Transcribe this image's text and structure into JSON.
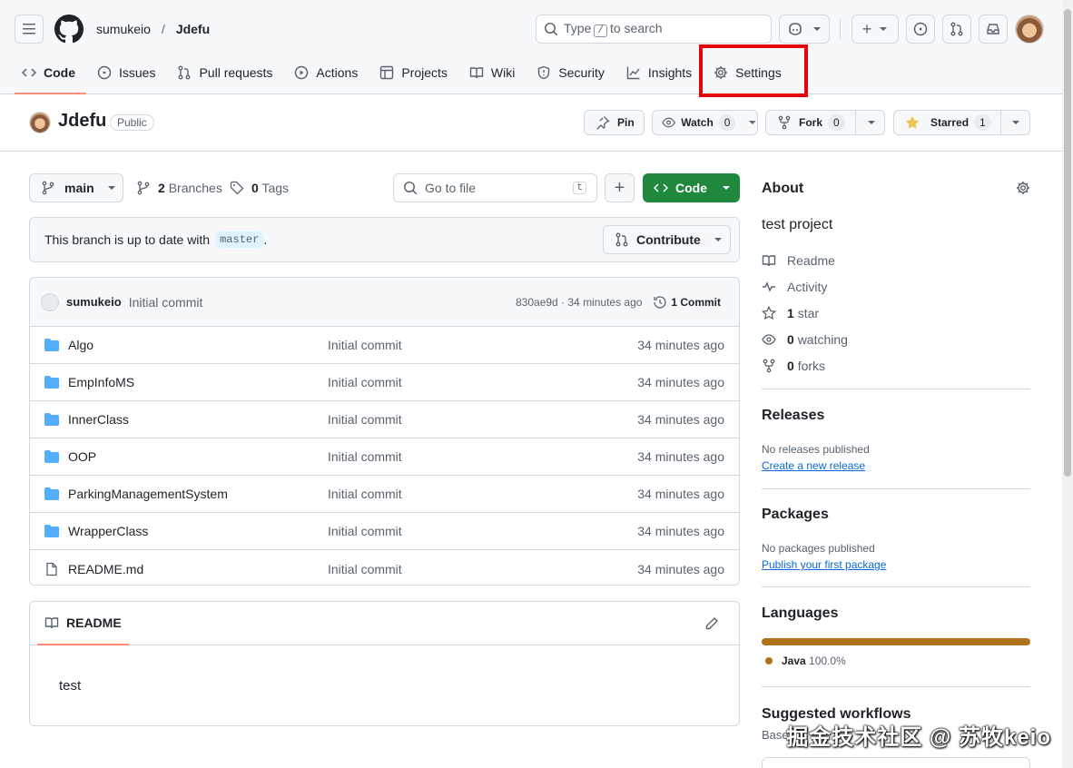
{
  "header": {
    "owner": "sumukeio",
    "separator": "/",
    "repo": "Jdefu",
    "search_type": "Type",
    "search_key": "/",
    "search_rest": "to search",
    "plus_label": "+"
  },
  "tabs": [
    {
      "label": "Code"
    },
    {
      "label": "Issues"
    },
    {
      "label": "Pull requests"
    },
    {
      "label": "Actions"
    },
    {
      "label": "Projects"
    },
    {
      "label": "Wiki"
    },
    {
      "label": "Security"
    },
    {
      "label": "Insights"
    },
    {
      "label": "Settings"
    }
  ],
  "repo": {
    "name": "Jdefu",
    "visibility": "Public",
    "pin": "Pin",
    "watch": "Watch",
    "watch_count": "0",
    "fork": "Fork",
    "fork_count": "0",
    "starred": "Starred",
    "star_count": "1"
  },
  "toolbar": {
    "branch": "main",
    "branches_count": "2",
    "branches_label": "Branches",
    "tags_count": "0",
    "tags_label": "Tags",
    "goto_placeholder": "Go to file",
    "goto_key": "t",
    "add": "+",
    "code": "Code"
  },
  "branch_status": {
    "text": "This branch is up to date with",
    "ref": "master",
    "period": ".",
    "contribute": "Contribute"
  },
  "commit": {
    "author": "sumukeio",
    "message": "Initial commit",
    "meta": "830ae9d · 34 minutes ago",
    "count": "1 Commit"
  },
  "files": [
    {
      "name": "Algo",
      "type": "folder",
      "message": "Initial commit",
      "time": "34 minutes ago"
    },
    {
      "name": "EmpInfoMS",
      "type": "folder",
      "message": "Initial commit",
      "time": "34 minutes ago"
    },
    {
      "name": "InnerClass",
      "type": "folder",
      "message": "Initial commit",
      "time": "34 minutes ago"
    },
    {
      "name": "OOP",
      "type": "folder",
      "message": "Initial commit",
      "time": "34 minutes ago"
    },
    {
      "name": "ParkingManagementSystem",
      "type": "folder",
      "message": "Initial commit",
      "time": "34 minutes ago"
    },
    {
      "name": "WrapperClass",
      "type": "folder",
      "message": "Initial commit",
      "time": "34 minutes ago"
    },
    {
      "name": "README.md",
      "type": "file",
      "message": "Initial commit",
      "time": "34 minutes ago"
    }
  ],
  "readme": {
    "title": "README",
    "content": "test"
  },
  "about": {
    "title": "About",
    "description": "test project",
    "readme": "Readme",
    "activity": "Activity",
    "stars_count": "1",
    "stars_label": "star",
    "watching_count": "0",
    "watching_label": "watching",
    "forks_count": "0",
    "forks_label": "forks"
  },
  "releases": {
    "title": "Releases",
    "empty": "No releases published",
    "link": "Create a new release"
  },
  "packages": {
    "title": "Packages",
    "empty": "No packages published",
    "link": "Publish your first package"
  },
  "languages": {
    "title": "Languages",
    "items": [
      {
        "name": "Java",
        "percent": "100.0%",
        "color": "#b07219",
        "share": 1.0
      }
    ]
  },
  "workflows": {
    "title": "Suggested workflows",
    "sub": "Based"
  },
  "watermark": "掘金技术社区 @ 苏牧keio",
  "colors": {
    "accent_green": "#1f883d",
    "highlight_box": "#e8000b",
    "tab_underline": "#fd8c73",
    "folder": "#54aeff",
    "link": "#0969da"
  }
}
